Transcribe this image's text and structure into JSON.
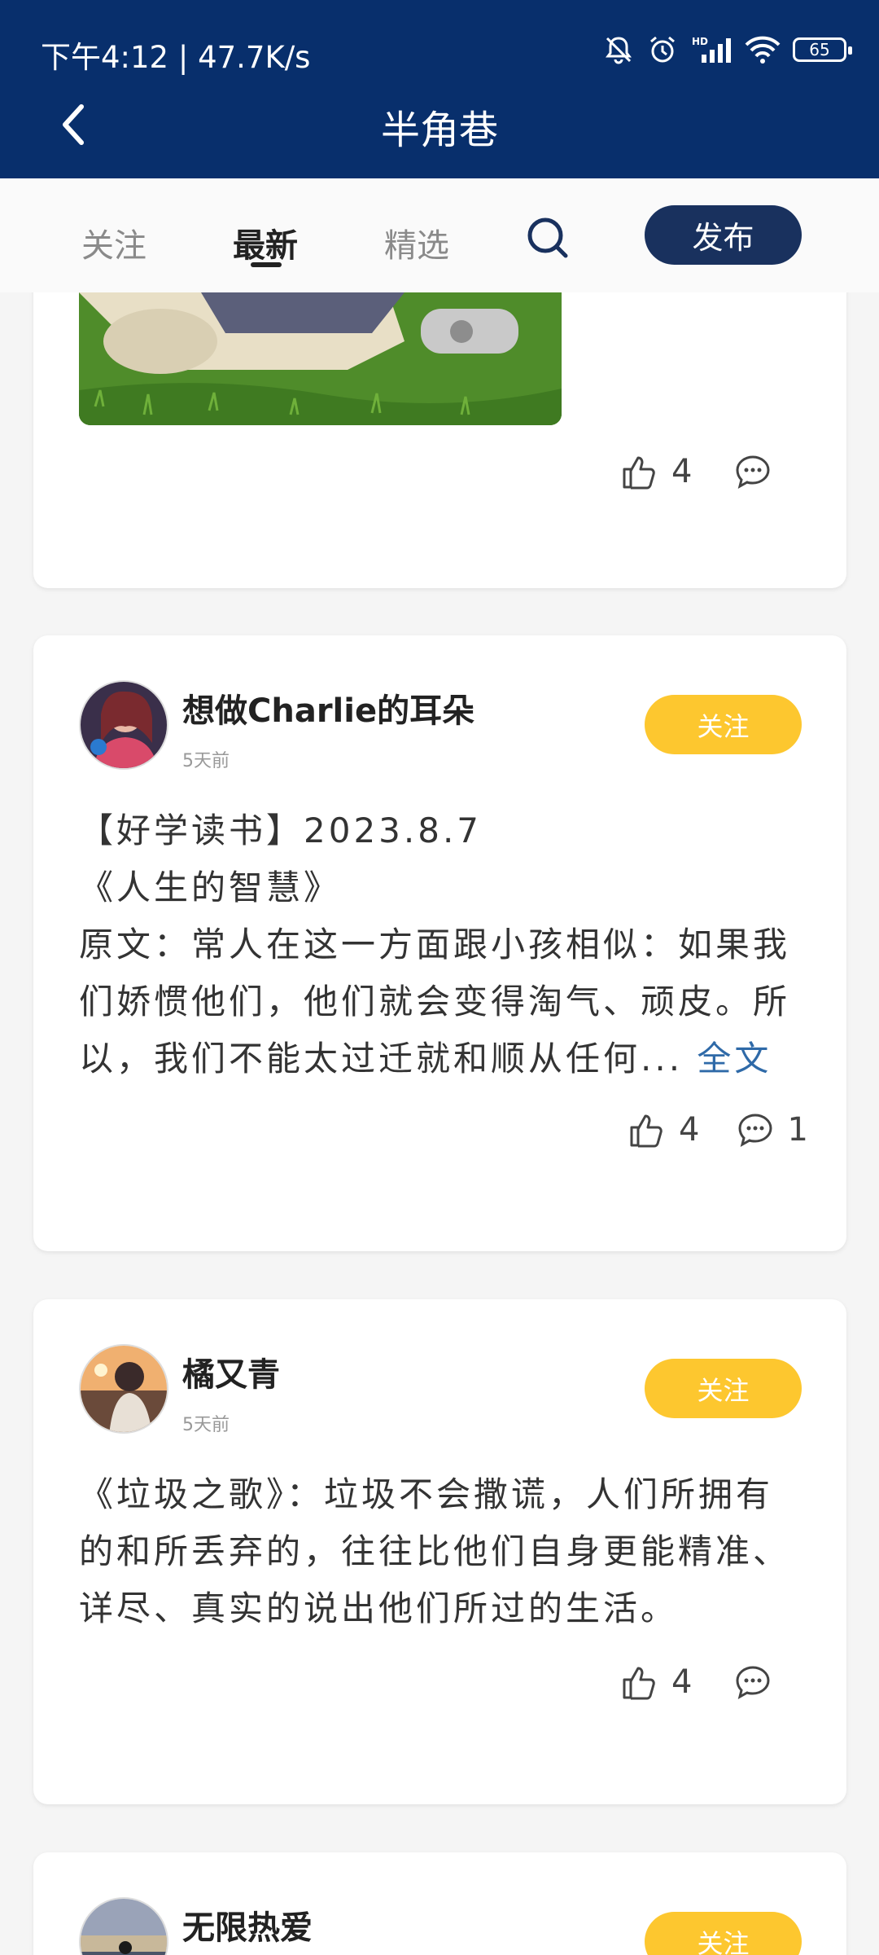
{
  "status": {
    "time_speed": "下午4:12 | 47.7K/s",
    "battery": "65"
  },
  "header": {
    "title": "半角巷"
  },
  "tabs": [
    {
      "label": "关注"
    },
    {
      "label": "最新"
    },
    {
      "label": "精选"
    }
  ],
  "publish_label": "发布",
  "posts": [
    {
      "likes": "4"
    },
    {
      "username": "想做Charlie的耳朵",
      "time": "5天前",
      "follow": "关注",
      "line1": "【好学读书】2023.8.7",
      "line2": "《人生的智慧》",
      "line3": "原文：常人在这一方面跟小孩相似：如果我",
      "line4": "们娇惯他们，他们就会变得淘气、顽皮。所",
      "line5": "以，我们不能太过迁就和顺从任何...",
      "more": "全文",
      "likes": "4",
      "comments": "1"
    },
    {
      "username": "橘又青",
      "time": "5天前",
      "follow": "关注",
      "line1": "《垃圾之歌》：垃圾不会撒谎，人们所拥有",
      "line2": "的和所丢弃的，往往比他们自身更能精准、",
      "line3": "详尽、真实的说出他们所过的生活。",
      "likes": "4"
    },
    {
      "username": "无限热爱",
      "follow": "关注"
    }
  ]
}
